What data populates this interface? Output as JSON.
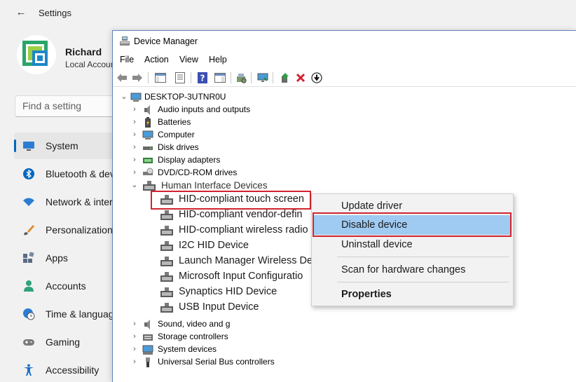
{
  "settings": {
    "title": "Settings",
    "user": {
      "name": "Richard",
      "account_type": "Local Account"
    },
    "search": {
      "placeholder": "Find a setting"
    },
    "nav": [
      {
        "label": "System",
        "icon": "monitor-icon",
        "active": true
      },
      {
        "label": "Bluetooth & devices",
        "icon": "bluetooth-icon"
      },
      {
        "label": "Network & internet",
        "icon": "wifi-icon"
      },
      {
        "label": "Personalization",
        "icon": "brush-icon"
      },
      {
        "label": "Apps",
        "icon": "apps-icon"
      },
      {
        "label": "Accounts",
        "icon": "person-icon"
      },
      {
        "label": "Time & language",
        "icon": "clock-globe-icon"
      },
      {
        "label": "Gaming",
        "icon": "gamepad-icon"
      },
      {
        "label": "Accessibility",
        "icon": "accessibility-icon"
      }
    ]
  },
  "device_manager": {
    "title": "Device Manager",
    "menu": [
      "File",
      "Action",
      "View",
      "Help"
    ],
    "toolbar": [
      "back-icon",
      "forward-icon",
      "show-hide-console-tree-icon",
      "properties-icon",
      "help-icon",
      "action-pane-icon",
      "scan-hardware-icon",
      "monitor-icon",
      "update-driver-icon",
      "uninstall-icon",
      "disable-icon"
    ],
    "root": "DESKTOP-3UTNR0U",
    "categories": [
      {
        "label": "Audio inputs and outputs",
        "icon": "speaker-icon"
      },
      {
        "label": "Batteries",
        "icon": "battery-icon"
      },
      {
        "label": "Computer",
        "icon": "computer-icon"
      },
      {
        "label": "Disk drives",
        "icon": "disk-drive-icon"
      },
      {
        "label": "Display adapters",
        "icon": "display-adapter-icon"
      },
      {
        "label": "DVD/CD-ROM drives",
        "icon": "dvd-drive-icon"
      }
    ],
    "expanded_category": {
      "label": "Human Interface Devices",
      "children": [
        "HID-compliant touch screen",
        "HID-compliant vendor-defin",
        "HID-compliant wireless radio",
        "I2C HID Device",
        "Launch Manager Wireless De",
        "Microsoft Input Configuratio",
        "Synaptics HID Device",
        "USB Input Device"
      ]
    },
    "categories_after": [
      {
        "label": "Sound, video and g",
        "icon": "speaker-icon"
      },
      {
        "label": "Storage controllers",
        "icon": "storage-controller-icon"
      },
      {
        "label": "System devices",
        "icon": "system-devices-icon"
      },
      {
        "label": "Universal Serial Bus controllers",
        "icon": "usb-icon"
      }
    ]
  },
  "context_menu": {
    "items": [
      {
        "label": "Update driver"
      },
      {
        "label": "Disable device",
        "selected": true
      },
      {
        "label": "Uninstall device"
      },
      {
        "label": "Scan for hardware changes"
      },
      {
        "label": "Properties",
        "bold": true
      }
    ]
  },
  "colors": {
    "highlight_box": "#d1242f",
    "menu_selection": "#9fcaf1",
    "accent": "#0067c0"
  }
}
